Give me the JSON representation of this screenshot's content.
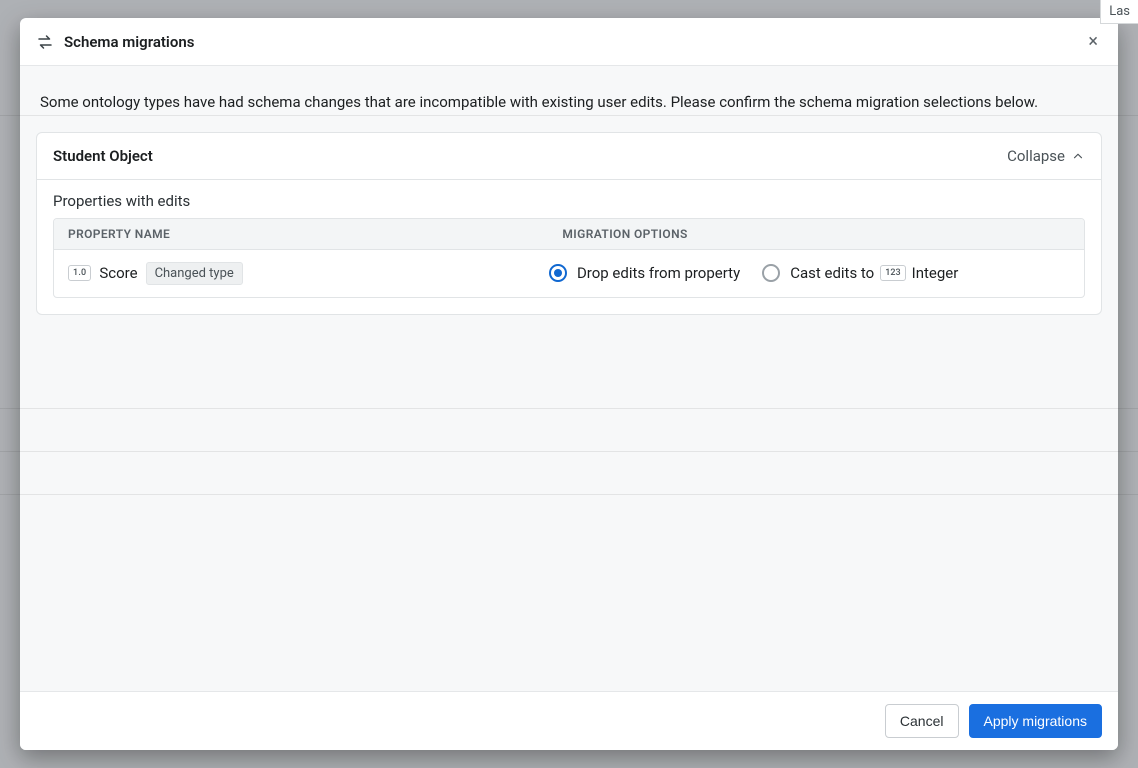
{
  "background": {
    "right_fragment": "Las"
  },
  "modal": {
    "title": "Schema migrations",
    "intro": "Some ontology types have had schema changes that are incompatible with existing user edits. Please confirm the schema migration selections below.",
    "close_symbol": "×",
    "section": {
      "title": "Student Object",
      "collapse_label": "Collapse",
      "subheading": "Properties with edits",
      "columns": {
        "property": "PROPERTY NAME",
        "options": "MIGRATION OPTIONS"
      },
      "rows": [
        {
          "type_badge": "1.0",
          "name": "Score",
          "chip": "Changed type",
          "options": {
            "drop": {
              "label": "Drop edits from property",
              "selected": true
            },
            "cast": {
              "label_prefix": "Cast edits to",
              "type_tag": "123",
              "type_name": "Integer",
              "selected": false
            }
          }
        }
      ]
    },
    "footer": {
      "cancel": "Cancel",
      "apply": "Apply migrations"
    }
  }
}
